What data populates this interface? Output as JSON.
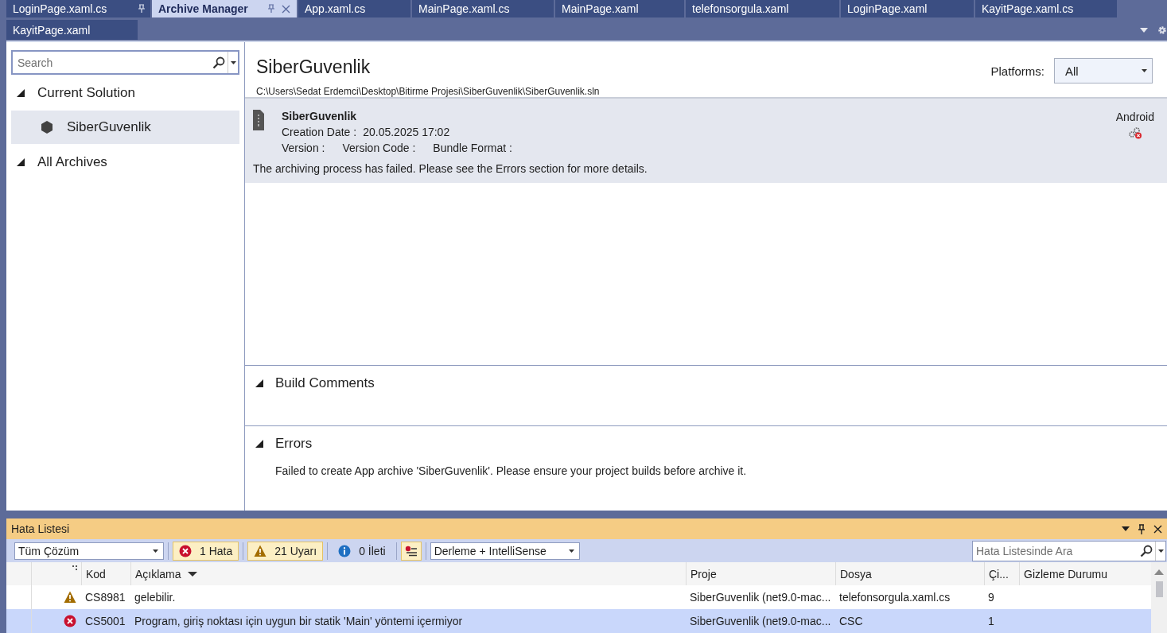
{
  "tabs": [
    {
      "label": "LoginPage.xaml.cs",
      "selected": false,
      "pinned": true
    },
    {
      "label": "Archive Manager",
      "selected": true,
      "pinned": true
    },
    {
      "label": "App.xaml.cs",
      "selected": false,
      "pinned": false
    },
    {
      "label": "MainPage.xaml.cs",
      "selected": false,
      "pinned": false
    },
    {
      "label": "MainPage.xaml",
      "selected": false,
      "pinned": false
    },
    {
      "label": "telefonsorgula.xaml",
      "selected": false,
      "pinned": false
    },
    {
      "label": "LoginPage.xaml",
      "selected": false,
      "pinned": false
    },
    {
      "label": "KayitPage.xaml.cs",
      "selected": false,
      "pinned": false
    },
    {
      "label": "KayitPage.xaml",
      "selected": false,
      "pinned": false
    }
  ],
  "sidebar": {
    "search": {
      "placeholder": "Search"
    },
    "groups": [
      {
        "label": "Current Solution",
        "expanded": true,
        "children": [
          {
            "label": "SiberGuvenlik",
            "selected": true
          }
        ]
      },
      {
        "label": "All Archives",
        "expanded": true
      }
    ]
  },
  "solution": {
    "title": "SiberGuvenlik",
    "path": "C:\\Users\\Sedat Erdemci\\Desktop\\Bitirme  Projesi\\SiberGuvenlik\\SiberGuvenlik.sln",
    "platforms_label": "Platforms:",
    "platforms_value": "All"
  },
  "archives": [
    {
      "name": "SiberGuvenlik",
      "creation_label": "Creation Date :",
      "creation_value": "20.05.2025 17:02",
      "version_label": "Version :",
      "version_code_label": "Version Code :",
      "bundle_format_label": "Bundle Format :",
      "message": "The archiving process has failed. Please see the Errors section for more details.",
      "platform": "Android",
      "selected": true
    }
  ],
  "sections": [
    {
      "title": "Build Comments",
      "expanded": true
    },
    {
      "title": "Errors",
      "expanded": true,
      "text": "Failed to create App archive 'SiberGuvenlik'. Please ensure your project builds before archive it."
    }
  ],
  "error_list": {
    "title": "Hata Listesi",
    "scope": "Tüm Çözüm",
    "filters": [
      {
        "kind": "error",
        "label": "1 Hata",
        "on": true
      },
      {
        "kind": "warning",
        "label": "21 Uyarı",
        "on": true
      },
      {
        "kind": "info",
        "label": "0 İleti",
        "on": false
      }
    ],
    "build_filter": "Derleme + IntelliSense",
    "search": {
      "placeholder": "Hata Listesinde Ara"
    },
    "columns": [
      "Kod",
      "Açıklama",
      "Proje",
      "Dosya",
      "Çi...",
      "Gizleme Durumu"
    ],
    "rows": [
      {
        "kind": "warning",
        "code": "CS8981",
        "description": "gelebilir.",
        "project": "SiberGuvenlik (net9.0-mac...",
        "file": "telefonsorgula.xaml.cs",
        "line": "9",
        "selected": false
      },
      {
        "kind": "error",
        "code": "CS5001",
        "description": "Program, giriş noktası için uygun bir statik 'Main' yöntemi içermiyor",
        "project": "SiberGuvenlik (net9.0-mac...",
        "file": "CSC",
        "line": "1",
        "selected": true
      }
    ]
  }
}
